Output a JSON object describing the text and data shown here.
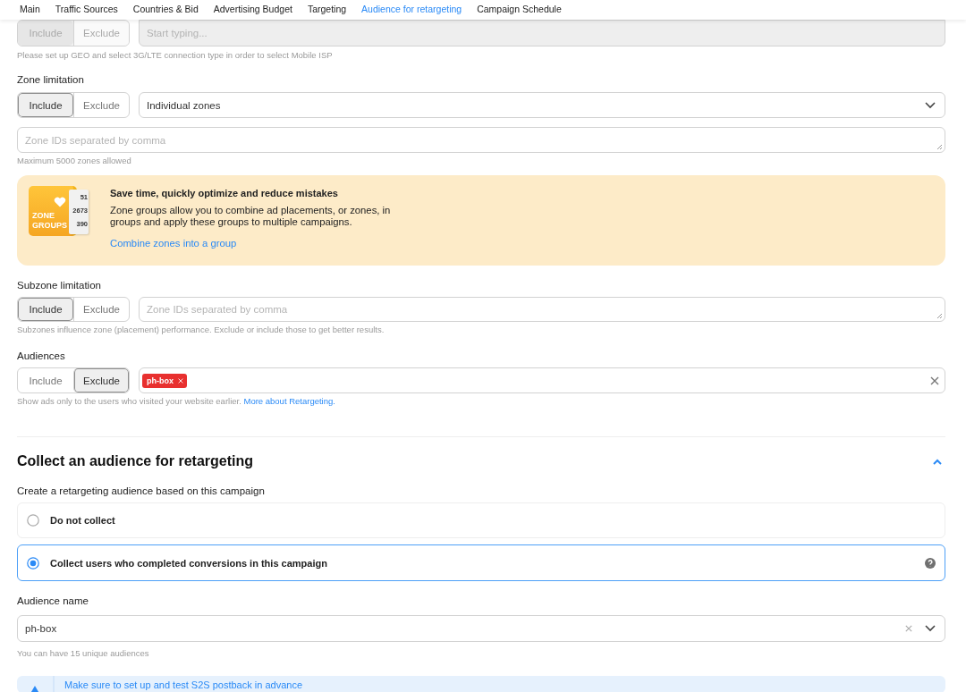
{
  "tabs": [
    {
      "label": "Main",
      "selected": false
    },
    {
      "label": "Traffic Sources",
      "selected": false
    },
    {
      "label": "Countries & Bid",
      "selected": false
    },
    {
      "label": "Advertising Budget",
      "selected": false
    },
    {
      "label": "Targeting",
      "selected": false
    },
    {
      "label": "Audience for retargeting",
      "selected": true
    },
    {
      "label": "Campaign Schedule",
      "selected": false
    }
  ],
  "isp": {
    "toggle": {
      "disabled": true,
      "options": [
        {
          "label": "Include",
          "selected": true
        },
        {
          "label": "Exclude",
          "selected": false
        }
      ]
    },
    "field": {
      "placeholder": "Start typing...",
      "disabled": true
    },
    "hint": "Please set up GEO and select 3G/LTE connection type in order to select Mobile ISP"
  },
  "zone_limitation": {
    "label": "Zone limitation",
    "toggle": {
      "disabled": false,
      "options": [
        {
          "label": "Include",
          "selected": true
        },
        {
          "label": "Exclude",
          "selected": false
        }
      ]
    },
    "select": {
      "value": "Individual zones"
    },
    "textarea": {
      "placeholder": "Zone IDs separated by comma"
    },
    "hint": "Maximum 5000 zones allowed"
  },
  "promo": {
    "logo": {
      "lines": [
        "ZONE",
        "GROUPS"
      ],
      "numbers": [
        "51",
        "2673",
        "390"
      ]
    },
    "title": "Save time, quickly optimize and reduce mistakes",
    "text": "Zone groups allow you to combine ad placements, or zones, in groups and apply these groups to multiple campaigns.",
    "link": "Combine zones into a group"
  },
  "subzone_limitation": {
    "label": "Subzone limitation",
    "toggle": {
      "disabled": false,
      "options": [
        {
          "label": "Include",
          "selected": true
        },
        {
          "label": "Exclude",
          "selected": false
        }
      ]
    },
    "textarea": {
      "placeholder": "Zone IDs separated by comma"
    },
    "hint": "Subzones influence zone (placement) performance. Exclude or include those to get better results."
  },
  "audiences": {
    "label": "Audiences",
    "toggle": {
      "disabled": false,
      "options": [
        {
          "label": "Include",
          "selected": false
        },
        {
          "label": "Exclude",
          "selected": true
        }
      ]
    },
    "tags": [
      {
        "label": "ph-box",
        "color": "#e8302f"
      }
    ],
    "hint": "Show ads only to the users who visited your website earlier.",
    "hint_link": "More about Retargeting."
  },
  "collect": {
    "title": "Collect an audience for retargeting",
    "expanded": true,
    "subtitle": "Create a retargeting audience based on this campaign",
    "options": [
      {
        "label": "Do not collect",
        "selected": false,
        "help": false
      },
      {
        "label": "Collect users who completed conversions in this campaign",
        "selected": true,
        "help": true
      }
    ],
    "audience_name": {
      "label": "Audience name",
      "value": "ph-box"
    },
    "hint": "You can have 15 unique audiences",
    "alert": {
      "text": "Make sure to set up and test S2S postback in advance"
    }
  }
}
